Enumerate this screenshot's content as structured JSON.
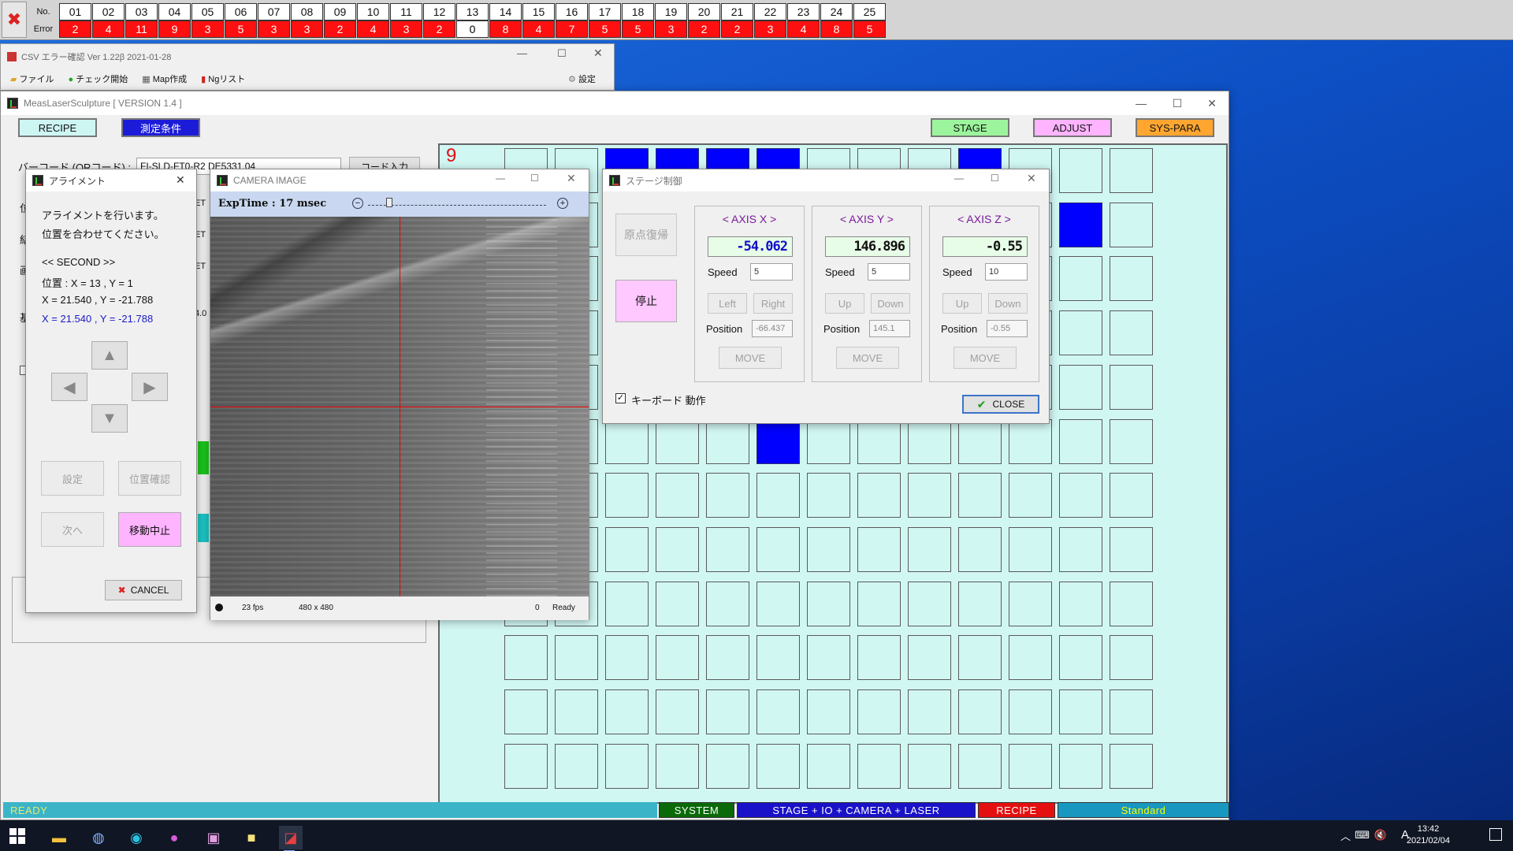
{
  "error_bar": {
    "label_no": "No.",
    "label_error": "Error",
    "numbers": [
      "01",
      "02",
      "03",
      "04",
      "05",
      "06",
      "07",
      "08",
      "09",
      "10",
      "11",
      "12",
      "13",
      "14",
      "15",
      "16",
      "17",
      "18",
      "19",
      "20",
      "21",
      "22",
      "23",
      "24",
      "25"
    ],
    "errors": [
      "2",
      "4",
      "11",
      "9",
      "3",
      "5",
      "3",
      "3",
      "2",
      "4",
      "3",
      "2",
      "0",
      "8",
      "4",
      "7",
      "5",
      "5",
      "3",
      "2",
      "2",
      "3",
      "4",
      "8",
      "5"
    ]
  },
  "csv_window": {
    "title": "CSV エラー確認 Ver 1.22β 2021-01-28",
    "menu": [
      "ファイル",
      "チェック開始",
      "Map作成",
      "Ngリスト"
    ],
    "settings": "設定"
  },
  "main_window": {
    "title": "MeasLaserSculpture [ VERSION 1.4 ]",
    "buttons": {
      "recipe": "RECIPE",
      "measure": "測定条件",
      "stage": "STAGE",
      "adjust": "ADJUST",
      "syspara": "SYS-PARA"
    },
    "barcode_label": "バーコード (QRコード) :",
    "barcode_value": "FI-SLD-FT0-R2 DE5331.04",
    "code_input": "コード入力",
    "partial_labels": [
      "位",
      "結",
      "画",
      "基"
    ],
    "partial_values": [
      "ET",
      "ET",
      "ET",
      "4.0"
    ],
    "grid_number": "9"
  },
  "status_bar": {
    "ready": "READY",
    "system": "SYSTEM",
    "stage": "STAGE + IO + CAMERA + LASER",
    "recipe": "RECIPE",
    "standard": "Standard"
  },
  "align_window": {
    "title": "アライメント",
    "msg1": "アライメントを行います。",
    "msg2": "位置を合わせてください。",
    "second": "<< SECOND >>",
    "position": "位置 : X = 13 , Y = 1",
    "coord1": "X = 21.540 , Y = -21.788",
    "coord2": "X = 21.540 , Y = -21.788",
    "btn_set": "設定",
    "btn_check": "位置確認",
    "btn_next": "次へ",
    "btn_stop": "移動中止",
    "btn_cancel": "CANCEL"
  },
  "camera_window": {
    "title": "CAMERA IMAGE",
    "exptime": "ExpTime : 17 msec",
    "fps": "23 fps",
    "size": "480 x 480",
    "count": "0",
    "ready": "Ready",
    "exposure_slider": 0.1
  },
  "stage_window": {
    "title": "ステージ制御",
    "btn_home": "原点復帰",
    "btn_stop": "停止",
    "keyboard": "キーボード 動作",
    "close": "CLOSE",
    "speed_label": "Speed",
    "position_label": "Position",
    "move": "MOVE",
    "axes": [
      {
        "title": "< AXIS X >",
        "readout": "-54.062",
        "speed": "5",
        "btn1": "Left",
        "btn2": "Right",
        "position": "-66.437"
      },
      {
        "title": "< AXIS Y >",
        "readout": "146.896",
        "speed": "5",
        "btn1": "Up",
        "btn2": "Down",
        "position": "145.1"
      },
      {
        "title": "< AXIS Z >",
        "readout": "-0.55",
        "speed": "10",
        "btn1": "Up",
        "btn2": "Down",
        "position": "-0.55"
      }
    ]
  },
  "taskbar": {
    "time": "13:42",
    "date": "2021/02/04",
    "ime": "A"
  },
  "colors": {
    "error_red": "#ff1010",
    "cell": "#d1f7f3",
    "cell_on": "#0000ff",
    "status_green": "#0a6a0a"
  }
}
